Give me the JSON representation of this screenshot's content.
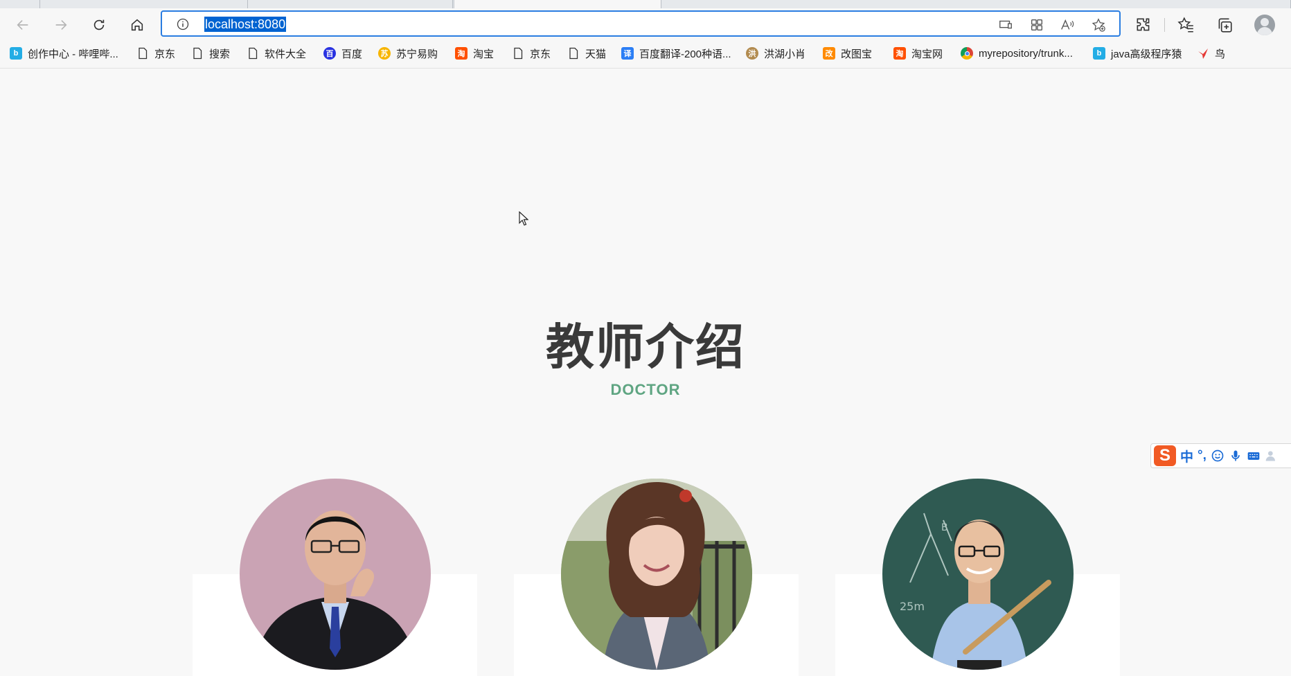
{
  "browser": {
    "address": "localhost:8080",
    "bookmarks": [
      {
        "label": "创作中心 - 哔哩哔...",
        "icon": "bilibili-icon",
        "color": "#23ade5"
      },
      {
        "label": "京东",
        "icon": "page-icon"
      },
      {
        "label": "搜索",
        "icon": "page-icon"
      },
      {
        "label": "软件大全",
        "icon": "page-icon"
      },
      {
        "label": "百度",
        "icon": "baidu-icon",
        "color": "#2932e1"
      },
      {
        "label": "苏宁易购",
        "icon": "suning-icon",
        "color": "#f7b500"
      },
      {
        "label": "淘宝",
        "icon": "taobao-icon",
        "color": "#ff5000"
      },
      {
        "label": "京东",
        "icon": "page-icon"
      },
      {
        "label": "天猫",
        "icon": "page-icon"
      },
      {
        "label": "百度翻译-200种语...",
        "icon": "baidu-translate-icon",
        "color": "#2b7ef5"
      },
      {
        "label": "洪湖小肖",
        "icon": "bird-icon",
        "color": "#b28b4f"
      },
      {
        "label": "改图宝",
        "icon": "gaitubao-icon",
        "color": "#ff8a00"
      },
      {
        "label": "淘宝网",
        "icon": "taobao-icon",
        "color": "#ff5000"
      },
      {
        "label": "myrepository/trunk...",
        "icon": "chrome-icon",
        "color": "#db4437"
      },
      {
        "label": "java高级程序猿",
        "icon": "bilibili-icon",
        "color": "#23ade5"
      },
      {
        "label": "鸟",
        "icon": "bird-red-icon",
        "color": "#e53935"
      }
    ]
  },
  "page": {
    "title": "教师介绍",
    "subtitle": "DOCTOR",
    "accent_color": "#5fa582"
  },
  "ime": {
    "logo": "S",
    "mode": "中",
    "punct": "°,"
  }
}
